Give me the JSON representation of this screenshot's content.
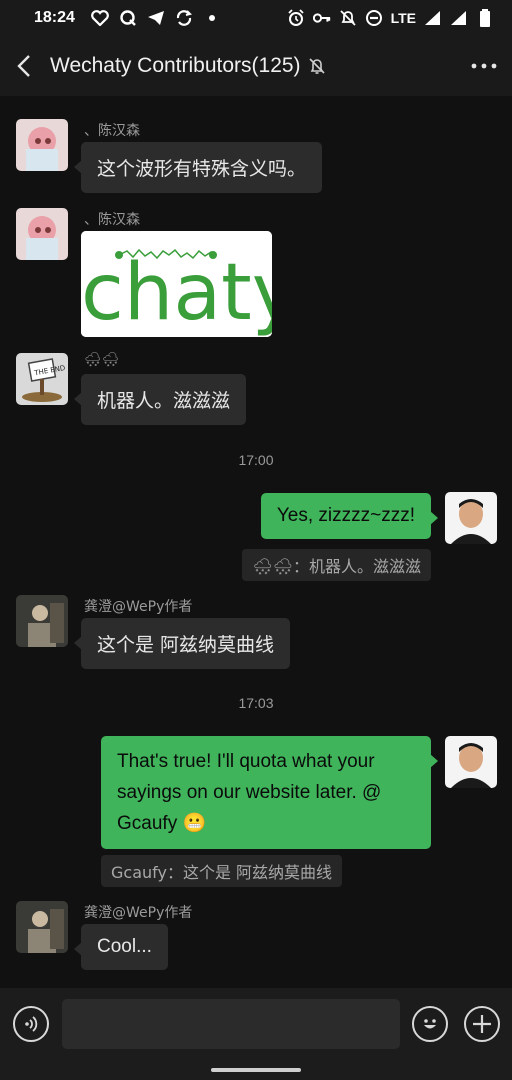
{
  "status_bar": {
    "time": "18:24",
    "network": "LTE",
    "left_icons": [
      "heart-icon",
      "q-icon",
      "telegram-icon",
      "sync-icon",
      "dot-icon"
    ],
    "right_icons": [
      "alarm-icon",
      "key-icon",
      "bell-off-icon",
      "dnd-icon",
      "signal-icon",
      "signal-icon",
      "battery-icon"
    ]
  },
  "header": {
    "title": "Wechaty Contributors(125)",
    "muted": true
  },
  "messages": [
    {
      "type": "text",
      "direction": "in",
      "sender": "、陈汉森",
      "text": "这个波形有特殊含义吗。"
    },
    {
      "type": "image",
      "direction": "in",
      "sender": "、陈汉森",
      "image_text": "chaty"
    },
    {
      "type": "text",
      "direction": "in",
      "sender": "🌨🌨",
      "text": "机器人。滋滋滋"
    },
    {
      "type": "timestamp",
      "text": "17:00"
    },
    {
      "type": "text",
      "direction": "out",
      "text": "Yes, zizzzz~zzz!",
      "quote": "🌨🌨：机器人。滋滋滋"
    },
    {
      "type": "text",
      "direction": "in",
      "sender": "龚澄@WePy作者",
      "text": "这个是 阿兹纳莫曲线"
    },
    {
      "type": "timestamp",
      "text": "17:03"
    },
    {
      "type": "text",
      "direction": "out",
      "text_lines": [
        "That's true! I'll quota what your",
        "sayings on our website later. @",
        "Gcaufy 😬"
      ],
      "quote": "Gcaufy：这个是 阿兹纳莫曲线"
    },
    {
      "type": "text",
      "direction": "in",
      "sender": "龚澄@WePy作者",
      "text": "Cool..."
    }
  ],
  "input": {
    "value": "",
    "placeholder": ""
  },
  "colors": {
    "background": "#111111",
    "bubble_in": "#2c2c2c",
    "bubble_out": "#3fb45a",
    "chaty_green": "#3a9e3a"
  }
}
